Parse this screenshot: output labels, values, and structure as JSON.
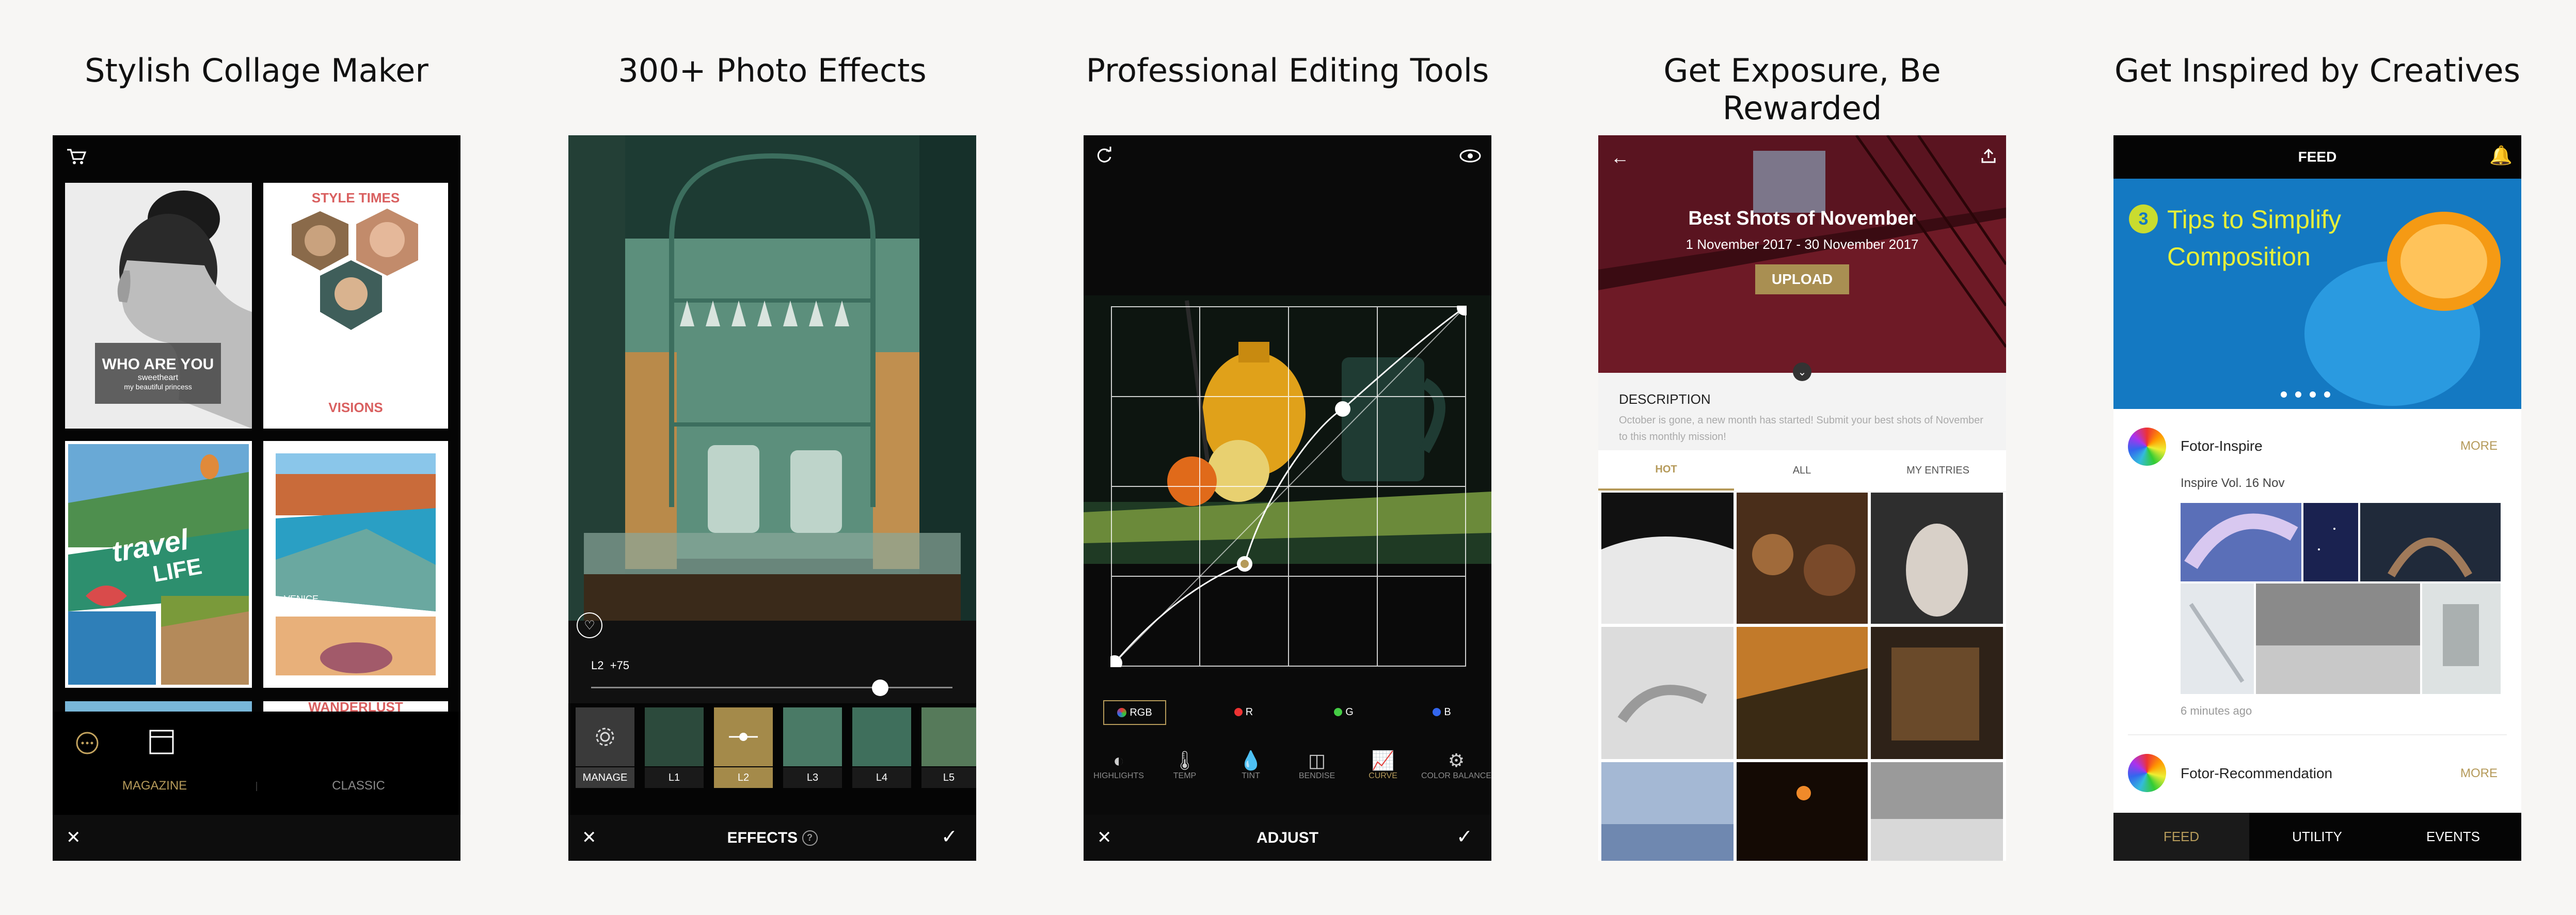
{
  "panels": {
    "p1": {
      "caption": "Stylish Collage Maker",
      "card1": {
        "title": "WHO ARE YOU",
        "line1": "sweetheart",
        "line2": "my beautiful princess"
      },
      "card2": {
        "title": "STYLE TIMES",
        "footer": "VISIONS"
      },
      "card3": {
        "word1": "travel",
        "word2": "LIFE"
      },
      "card4": {
        "label": "VENICE"
      },
      "card5": {
        "label": "WANDERLUST"
      },
      "tabs": [
        "MAGAZINE",
        "CLASSIC"
      ]
    },
    "p2": {
      "caption": "300+ Photo Effects",
      "slider_label": "L2",
      "slider_value": "+75",
      "slider_fraction": 0.8,
      "thumbs": [
        "MANAGE",
        "L1",
        "L2",
        "L3",
        "L4",
        "L5"
      ],
      "title": "EFFECTS"
    },
    "p3": {
      "caption": "Professional Editing Tools",
      "channels": [
        "RGB",
        "R",
        "G",
        "B"
      ],
      "tools": [
        "HIGHLIGHTS",
        "TEMP",
        "TINT",
        "BENDISE",
        "CURVE",
        "COLOR BALANCE"
      ],
      "title": "ADJUST"
    },
    "p4": {
      "caption": "Get Exposure, Be Rewarded",
      "event_title": "Best Shots of November",
      "event_dates": "1 November 2017 - 30 November 2017",
      "upload": "UPLOAD",
      "description_label": "DESCRIPTION",
      "description_text": "October is gone, a new month has started! Submit your best shots of November to this monthly mission!",
      "tabs": [
        "HOT",
        "ALL",
        "MY ENTRIES"
      ]
    },
    "p5": {
      "caption": "Get Inspired by Creatives",
      "header": "FEED",
      "banner_number": "3",
      "banner_line1": "Tips to Simplify",
      "banner_line2": "Composition",
      "post1": {
        "user": "Fotor-Inspire",
        "more": "MORE",
        "subtitle": "Inspire Vol. 16 Nov",
        "time": "6 minutes ago"
      },
      "post2": {
        "user": "Fotor-Recommendation",
        "more": "MORE"
      },
      "nav": [
        "FEED",
        "UTILITY",
        "EVENTS"
      ]
    }
  },
  "colors": {
    "gold": "#b59a5a",
    "background": "#f7f6f4",
    "banner_blue": "#1479c2"
  }
}
